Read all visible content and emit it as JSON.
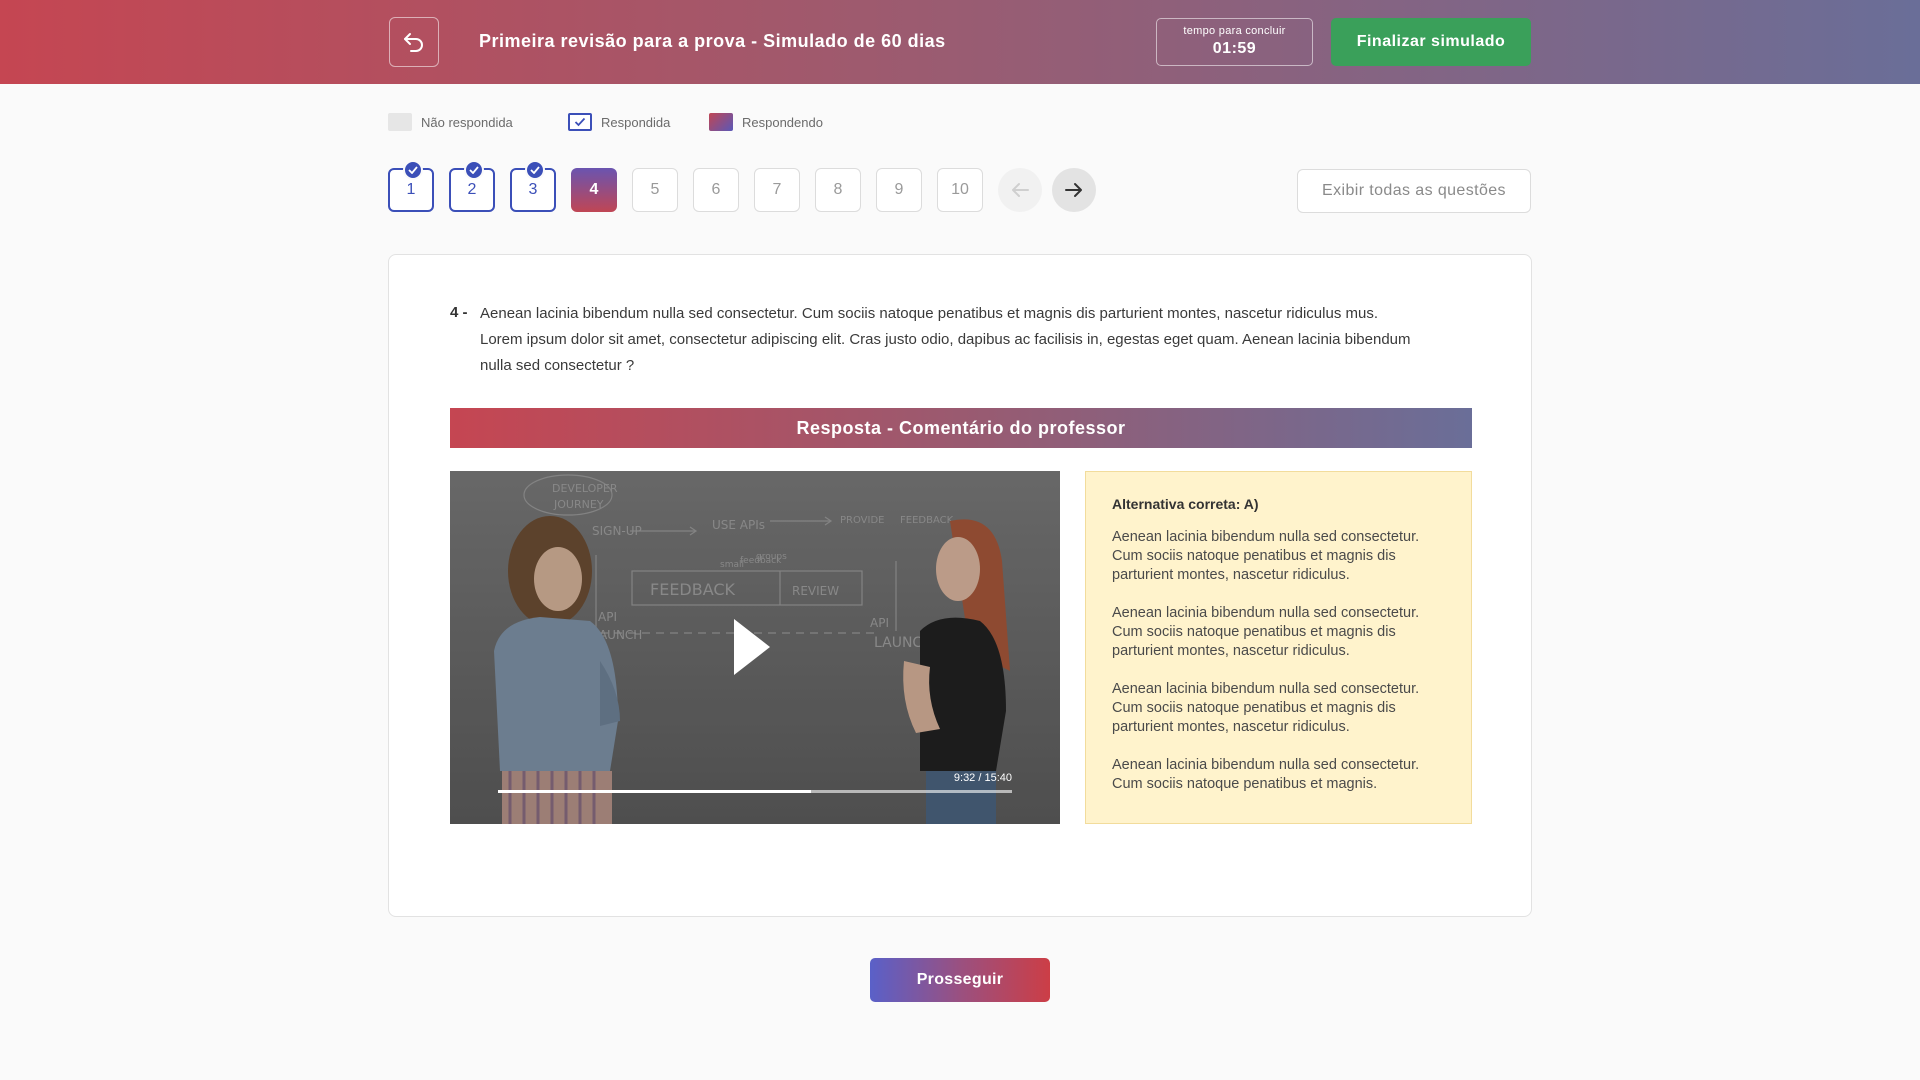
{
  "header": {
    "back_icon": "undo-arrow-icon",
    "title": "Primeira revisão para a prova - Simulado de 60 dias",
    "timer_label": "tempo para concluir",
    "timer_value": "01:59",
    "finish_label": "Finalizar simulado"
  },
  "legend": [
    {
      "label": "Não respondida",
      "state": "unanswered"
    },
    {
      "label": "Respondida",
      "state": "answered"
    },
    {
      "label": "Respondendo",
      "state": "current"
    }
  ],
  "questions": [
    {
      "number": "1",
      "state": "answered"
    },
    {
      "number": "2",
      "state": "answered"
    },
    {
      "number": "3",
      "state": "answered"
    },
    {
      "number": "4",
      "state": "current"
    },
    {
      "number": "5",
      "state": "unanswered"
    },
    {
      "number": "6",
      "state": "unanswered"
    },
    {
      "number": "7",
      "state": "unanswered"
    },
    {
      "number": "8",
      "state": "unanswered"
    },
    {
      "number": "9",
      "state": "unanswered"
    },
    {
      "number": "10",
      "state": "unanswered"
    }
  ],
  "nav": {
    "prev_icon": "arrow-left-icon",
    "next_icon": "arrow-right-icon",
    "show_all_label": "Exibir todas as questões"
  },
  "question": {
    "number": "4 -",
    "text": "Aenean lacinia bibendum nulla sed consectetur. Cum sociis natoque penatibus et magnis dis parturient montes, nascetur ridiculus mus. Lorem ipsum dolor sit amet, consectetur adipiscing elit. Cras justo odio, dapibus ac facilisis in, egestas eget quam. Aenean lacinia bibendum nulla sed consectetur ?"
  },
  "answer": {
    "banner": "Resposta - Comentário do professor",
    "video": {
      "time": "9:32 / 15:40",
      "progress": 0.6085,
      "whiteboard": [
        "DEVELOPER",
        "JOURNEY",
        "SIGN-UP",
        "USE APIs",
        "PROVIDE",
        "FEEDBACK",
        "FEEDBACK",
        "REVIEW",
        "API",
        "LAUNCH",
        "API",
        "LAUNCH",
        "small",
        "feedback",
        "groups"
      ]
    },
    "comment": {
      "title": "Alternativa correta: A)",
      "paragraphs": [
        "Aenean lacinia bibendum nulla sed consectetur. Cum sociis natoque penatibus et magnis dis parturient montes, nascetur ridiculus.",
        "Aenean lacinia bibendum nulla sed consectetur. Cum sociis natoque penatibus et magnis dis parturient montes, nascetur ridiculus.",
        "Aenean lacinia bibendum nulla sed consectetur. Cum sociis natoque penatibus et magnis dis parturient montes, nascetur ridiculus.",
        "Aenean lacinia bibendum nulla sed consectetur. Cum sociis natoque penatibus et magnis."
      ]
    }
  },
  "proceed_label": "Prosseguir",
  "colors": {
    "brand_red": "#c54652",
    "brand_blue": "#6a6e98",
    "answered_blue": "#3b4fb8",
    "success_green": "#3aa05a",
    "comment_bg": "#fff3cc"
  }
}
